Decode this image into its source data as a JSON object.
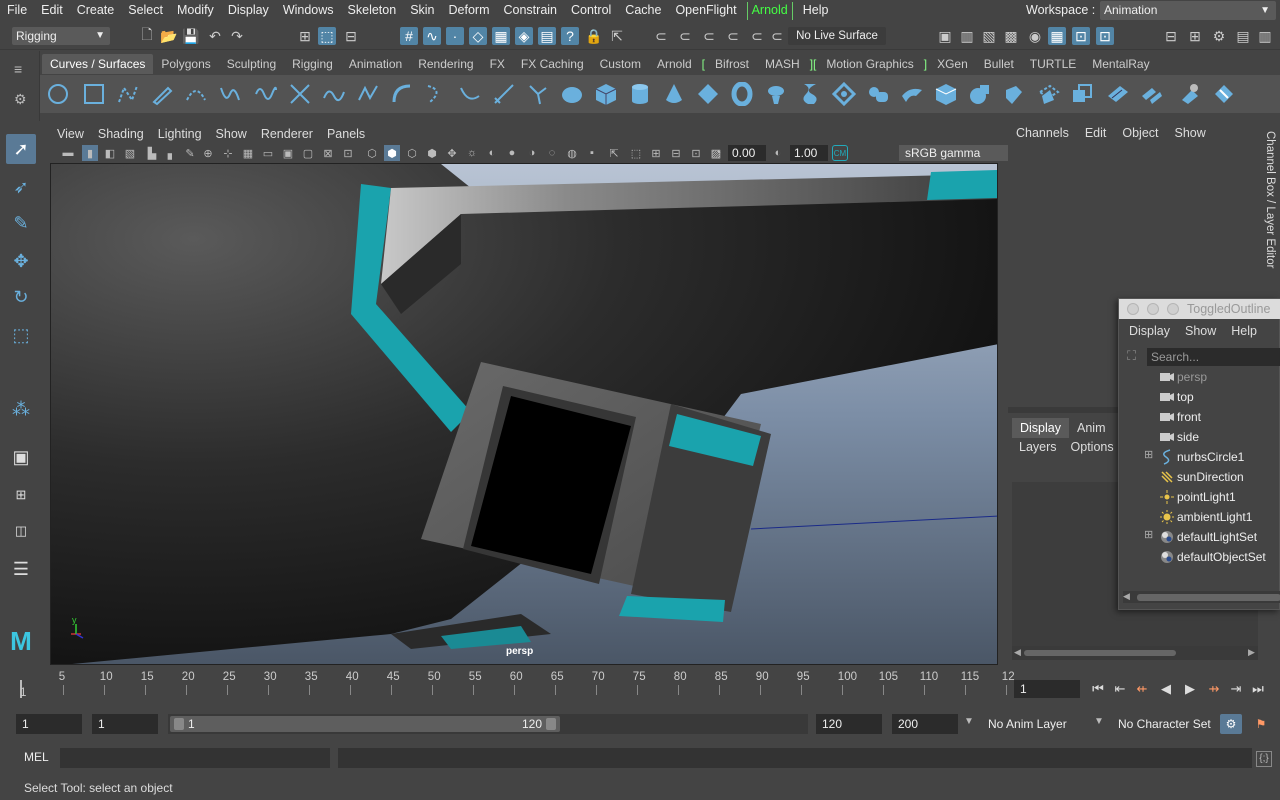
{
  "menubar": {
    "items": [
      "File",
      "Edit",
      "Create",
      "Select",
      "Modify",
      "Display",
      "Windows",
      "Skeleton",
      "Skin",
      "Deform",
      "Constrain",
      "Control",
      "Cache",
      "OpenFlight",
      "Arnold",
      "Help"
    ],
    "workspace_label": "Workspace :",
    "workspace_value": "Animation"
  },
  "statusline": {
    "mode": "Rigging",
    "live_surface": "No Live Surface"
  },
  "shelf": {
    "tabs": [
      "Curves / Surfaces",
      "Polygons",
      "Sculpting",
      "Rigging",
      "Animation",
      "Rendering",
      "FX",
      "FX Caching",
      "Custom",
      "Arnold",
      "[",
      "Bifrost",
      "MASH",
      "][",
      "Motion Graphics",
      "]",
      "XGen",
      "Bullet",
      "TURTLE",
      "MentalRay"
    ],
    "active_tab": "Curves / Surfaces"
  },
  "viewport": {
    "menu": [
      "View",
      "Shading",
      "Lighting",
      "Show",
      "Renderer",
      "Panels"
    ],
    "exposure": "0.00",
    "gamma_value": "1.00",
    "color_space": "sRGB gamma",
    "camera_label": "persp",
    "axis_y": "y"
  },
  "channel_box": {
    "menu": [
      "Channels",
      "Edit",
      "Object",
      "Show"
    ],
    "side_tab": "Channel Box / Layer Editor"
  },
  "layer_editor": {
    "tabs": [
      "Display",
      "Anim"
    ],
    "active_tab": "Display",
    "menu": [
      "Layers",
      "Options"
    ]
  },
  "outliner": {
    "title": "ToggledOutline",
    "menu": [
      "Display",
      "Show",
      "Help"
    ],
    "search_placeholder": "Search...",
    "items": [
      {
        "name": "persp",
        "icon": "camera-icon",
        "dim": true,
        "expand": false
      },
      {
        "name": "top",
        "icon": "camera-icon",
        "dim": false,
        "expand": false
      },
      {
        "name": "front",
        "icon": "camera-icon",
        "dim": false,
        "expand": false
      },
      {
        "name": "side",
        "icon": "camera-icon",
        "dim": false,
        "expand": false
      },
      {
        "name": "nurbsCircle1",
        "icon": "nurbs-curve-icon",
        "dim": false,
        "expand": true
      },
      {
        "name": "sunDirection",
        "icon": "directional-light-icon",
        "dim": false,
        "expand": false
      },
      {
        "name": "pointLight1",
        "icon": "point-light-icon",
        "dim": false,
        "expand": false
      },
      {
        "name": "ambientLight1",
        "icon": "ambient-light-icon",
        "dim": false,
        "expand": false
      },
      {
        "name": "defaultLightSet",
        "icon": "set-icon",
        "dim": false,
        "expand": true
      },
      {
        "name": "defaultObjectSet",
        "icon": "set-icon",
        "dim": false,
        "expand": false
      }
    ]
  },
  "timeline": {
    "start_label": "1",
    "ticks": [
      "5",
      "10",
      "15",
      "20",
      "25",
      "30",
      "35",
      "40",
      "45",
      "50",
      "55",
      "60",
      "65",
      "70",
      "75",
      "80",
      "85",
      "90",
      "95",
      "100",
      "105",
      "110",
      "115",
      "12"
    ],
    "current_frame": "1"
  },
  "range": {
    "start": "1",
    "playback_start": "1",
    "slider_start": "1",
    "slider_end": "120",
    "playback_end": "120",
    "end": "200",
    "anim_layer": "No Anim Layer",
    "character_set": "No Character Set"
  },
  "command": {
    "lang": "MEL"
  },
  "help_line": "Select Tool: select an object"
}
